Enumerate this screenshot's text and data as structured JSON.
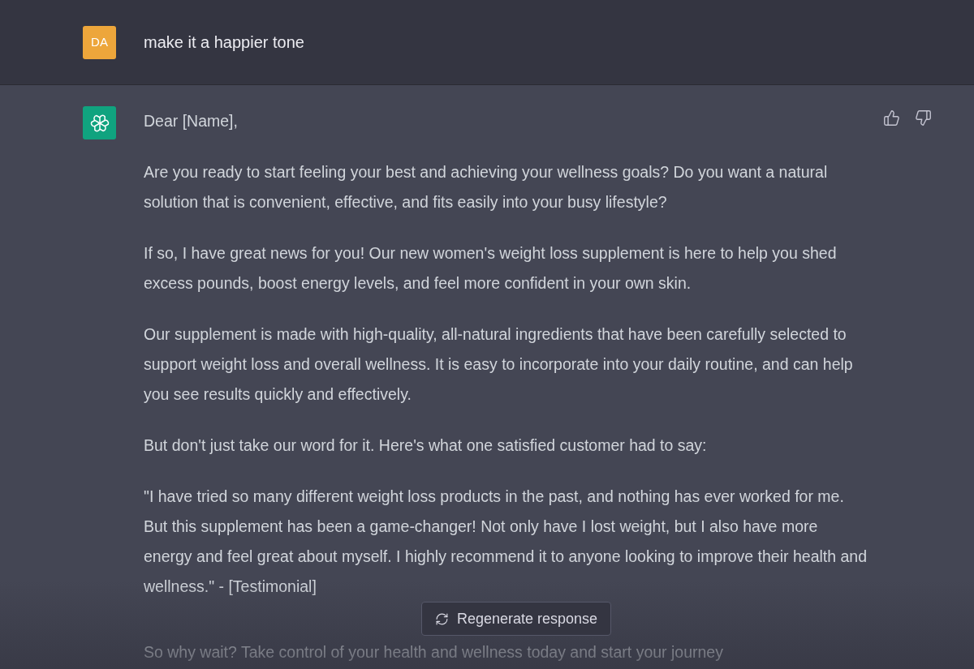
{
  "user_message": {
    "avatar": "DA",
    "text": "make it a happier tone"
  },
  "assistant_message": {
    "paragraphs": [
      "Dear [Name],",
      "Are you ready to start feeling your best and achieving your wellness goals? Do you want a natural solution that is convenient, effective, and fits easily into your busy lifestyle?",
      "If so, I have great news for you! Our new women's weight loss supplement is here to help you shed excess pounds, boost energy levels, and feel more confident in your own skin.",
      "Our supplement is made with high-quality, all-natural ingredients that have been carefully selected to support weight loss and overall wellness. It is easy to incorporate into your daily routine, and can help you see results quickly and effectively.",
      "But don't just take our word for it. Here's what one satisfied customer had to say:",
      "\"I have tried so many different weight loss products in the past, and nothing has ever worked for me. But this supplement has been a game-changer! Not only have I lost weight, but I also have more energy and feel great about myself. I highly recommend it to anyone looking to improve their health and wellness.\" - [Testimonial]",
      "So why wait? Take control of your health and wellness today and start your journey"
    ]
  },
  "regenerate_button": "Regenerate response"
}
